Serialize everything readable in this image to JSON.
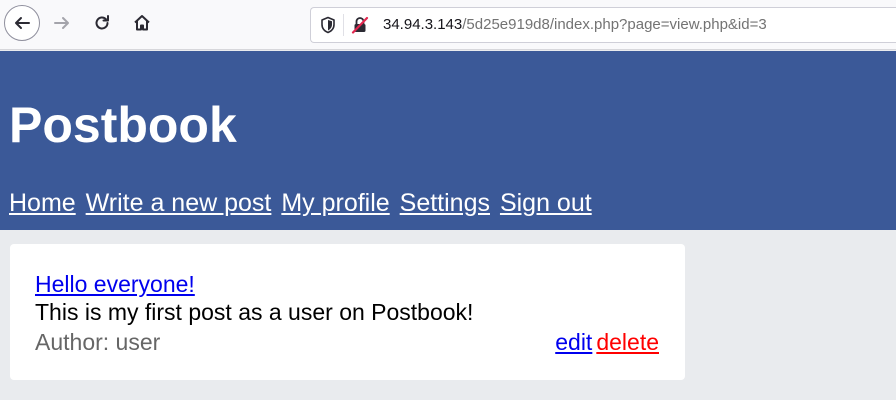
{
  "browser": {
    "url_host": "34.94.3.143",
    "url_path": "/5d25e919d8/index.php?page=view.php&id=3"
  },
  "header": {
    "title": "Postbook",
    "nav": [
      "Home",
      "Write a new post",
      "My profile",
      "Settings",
      "Sign out"
    ]
  },
  "post": {
    "title": "Hello everyone!",
    "body": "This is my first post as a user on Postbook!",
    "author_label": "Author: user",
    "edit_label": "edit",
    "delete_label": "delete"
  },
  "colors": {
    "header_bg": "#3b5998",
    "page_bg": "#e9ebee",
    "link": "#0000ee",
    "delete": "#ff0000"
  }
}
